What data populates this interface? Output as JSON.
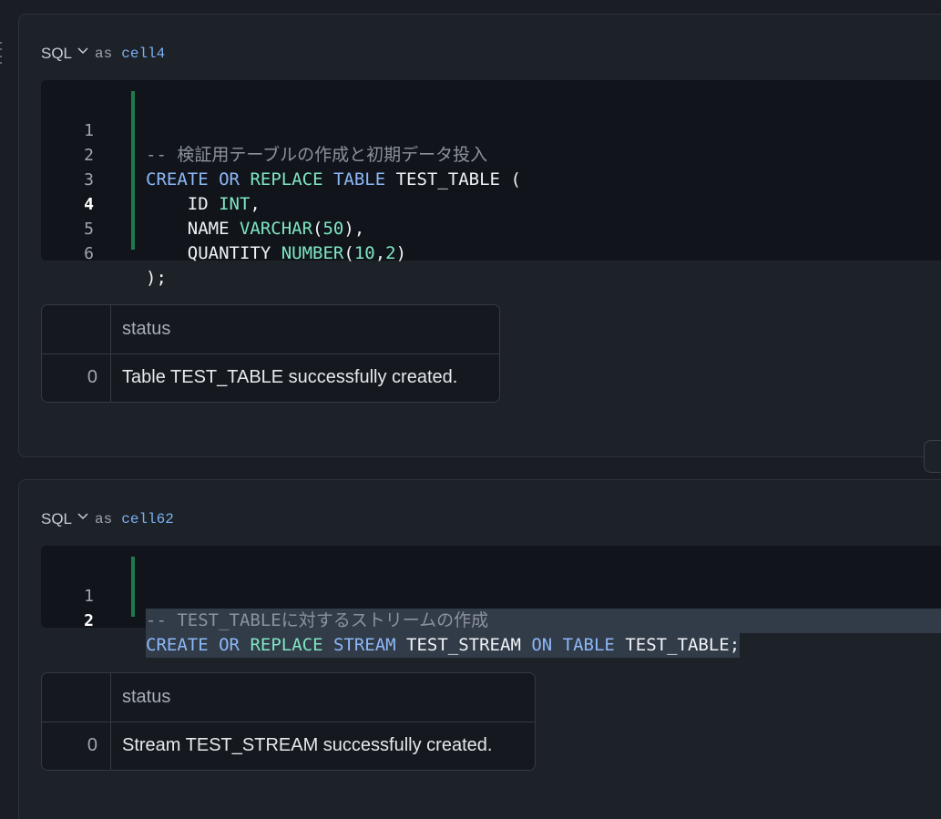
{
  "cells": [
    {
      "language": "SQL",
      "as_label": "as",
      "name": "cell4",
      "code_lines": [
        {
          "num": "1"
        },
        {
          "num": "2"
        },
        {
          "num": "3"
        },
        {
          "num": "4",
          "active": true
        },
        {
          "num": "5"
        },
        {
          "num": "6"
        }
      ],
      "code": {
        "l1_comment": "-- 検証用テーブルの作成と初期データ投入",
        "l2_kw1": "CREATE",
        "l2_kw2": "OR",
        "l2_kw3": "REPLACE",
        "l2_kw4": "TABLE",
        "l2_rest": " TEST_TABLE (",
        "l3_name": "    ID ",
        "l3_type": "INT",
        "l3_end": ",",
        "l4_name": "    NAME ",
        "l4_type": "VARCHAR",
        "l4_open": "(",
        "l4_num": "50",
        "l4_end": "),",
        "l5_name": "    QUANTITY ",
        "l5_type": "NUMBER",
        "l5_open": "(",
        "l5_num1": "10",
        "l5_comma": ",",
        "l5_num2": "2",
        "l5_end": ")",
        "l6": ");"
      },
      "result": {
        "column": "status",
        "rows": [
          {
            "index": "0",
            "value": "Table TEST_TABLE successfully created."
          }
        ]
      }
    },
    {
      "language": "SQL",
      "as_label": "as",
      "name": "cell62",
      "code_lines": [
        {
          "num": "1"
        },
        {
          "num": "2",
          "active": true
        }
      ],
      "code": {
        "l1_comment": "-- TEST_TABLEに対するストリームの作成",
        "l2_kw1": "CREATE",
        "l2_kw2": "OR",
        "l2_kw3": "REPLACE",
        "l2_kw4": "STREAM",
        "l2_mid": " TEST_STREAM ",
        "l2_kw5": "ON",
        "l2_kw6": "TABLE",
        "l2_end": " TEST_TABLE;"
      },
      "result": {
        "column": "status",
        "rows": [
          {
            "index": "0",
            "value": "Stream TEST_STREAM successfully created."
          }
        ]
      }
    }
  ],
  "colors": {
    "keyword": "#8cb8f8",
    "type": "#7ee7c2",
    "comment": "#8b929c",
    "cell_name": "#7ab0f2",
    "gutter_marker": "#1f7a4e"
  },
  "icons": {
    "language_dropdown": "chevron-down-icon",
    "drag_handle": "drag-handle-icon"
  }
}
